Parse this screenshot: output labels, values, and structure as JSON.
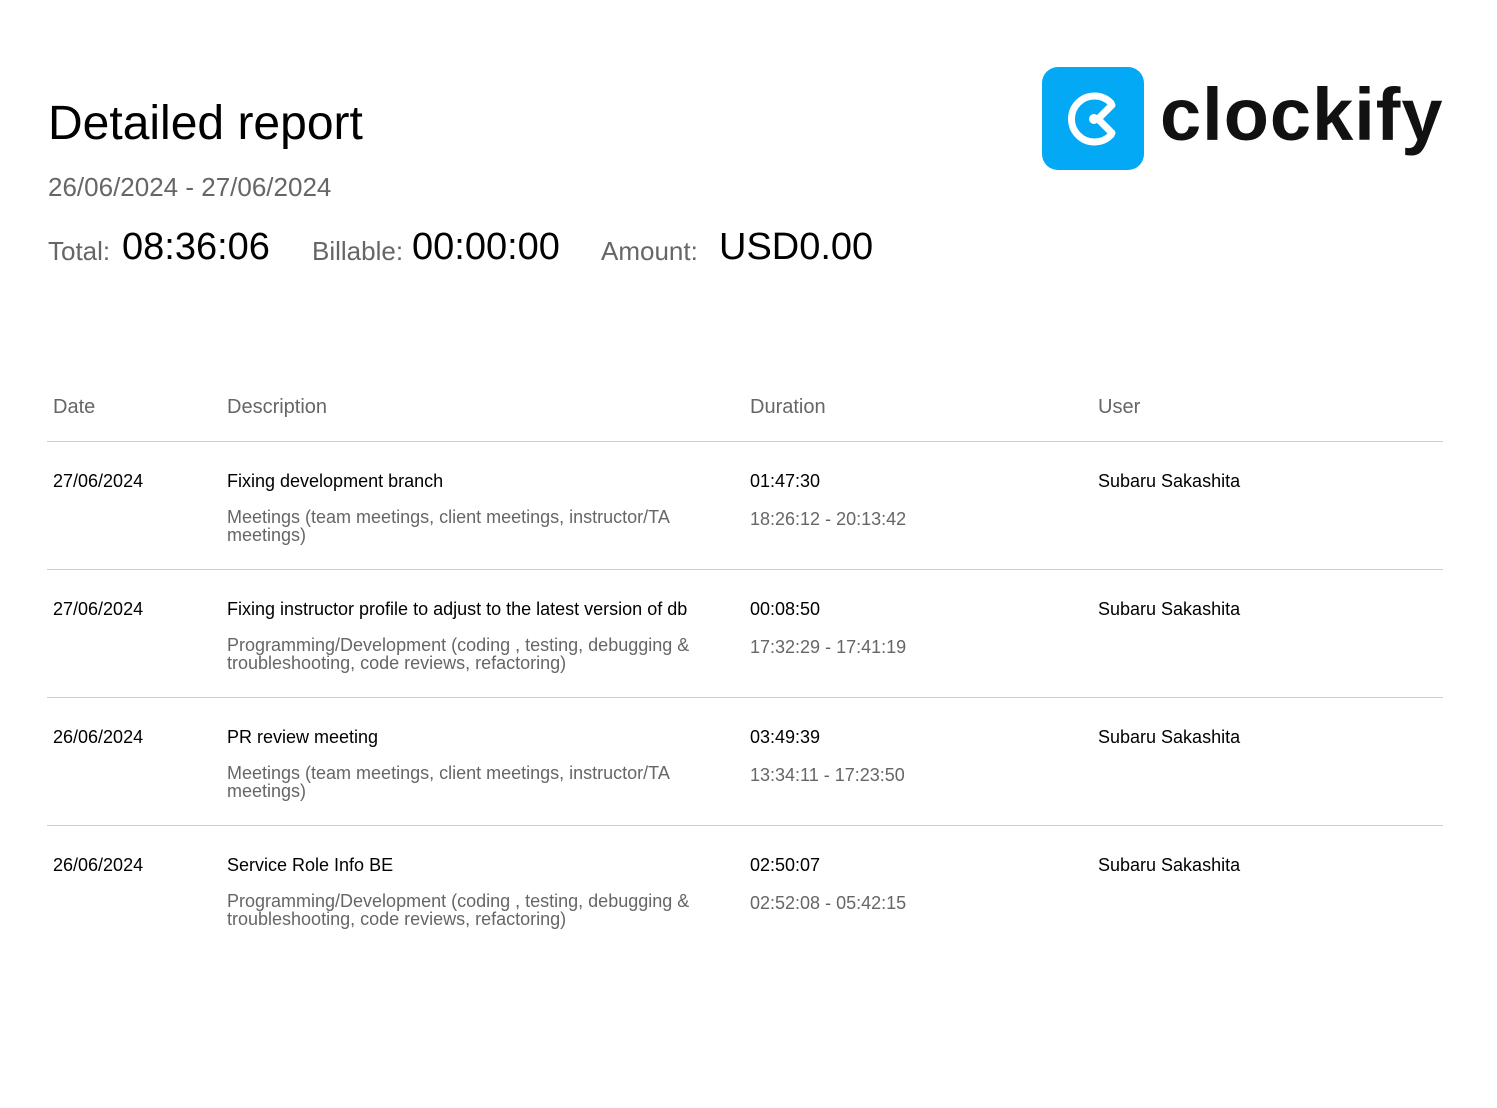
{
  "report": {
    "title": "Detailed report",
    "date_range": "26/06/2024 - 27/06/2024"
  },
  "totals": {
    "total_label": "Total:",
    "total_value": "08:36:06",
    "billable_label": "Billable:",
    "billable_value": "00:00:00",
    "amount_label": "Amount:",
    "amount_value": "USD0.00"
  },
  "logo": {
    "wordmark": "clockify",
    "brand_color": "#03a9f4",
    "icon": "clockify-logo-icon"
  },
  "table": {
    "headers": {
      "date": "Date",
      "description": "Description",
      "duration": "Duration",
      "user": "User"
    },
    "rows": [
      {
        "date": "27/06/2024",
        "description": "Fixing development branch",
        "project": "Meetings (team meetings, client meetings, instructor/TA meetings)",
        "duration": "01:47:30",
        "time_range": "18:26:12 - 20:13:42",
        "user": "Subaru Sakashita"
      },
      {
        "date": "27/06/2024",
        "description": "Fixing instructor profile to adjust to the latest version of db",
        "project": "Programming/Development (coding , testing, debugging & troubleshooting, code reviews, refactoring)",
        "duration": "00:08:50",
        "time_range": "17:32:29 - 17:41:19",
        "user": "Subaru Sakashita"
      },
      {
        "date": "26/06/2024",
        "description": "PR review meeting",
        "project": "Meetings (team meetings, client meetings, instructor/TA meetings)",
        "duration": "03:49:39",
        "time_range": "13:34:11 - 17:23:50",
        "user": "Subaru Sakashita"
      },
      {
        "date": "26/06/2024",
        "description": "Service Role Info BE",
        "project": "Programming/Development (coding , testing, debugging & troubleshooting, code reviews, refactoring)",
        "duration": "02:50:07",
        "time_range": "02:52:08 - 05:42:15",
        "user": "Subaru Sakashita"
      }
    ]
  }
}
